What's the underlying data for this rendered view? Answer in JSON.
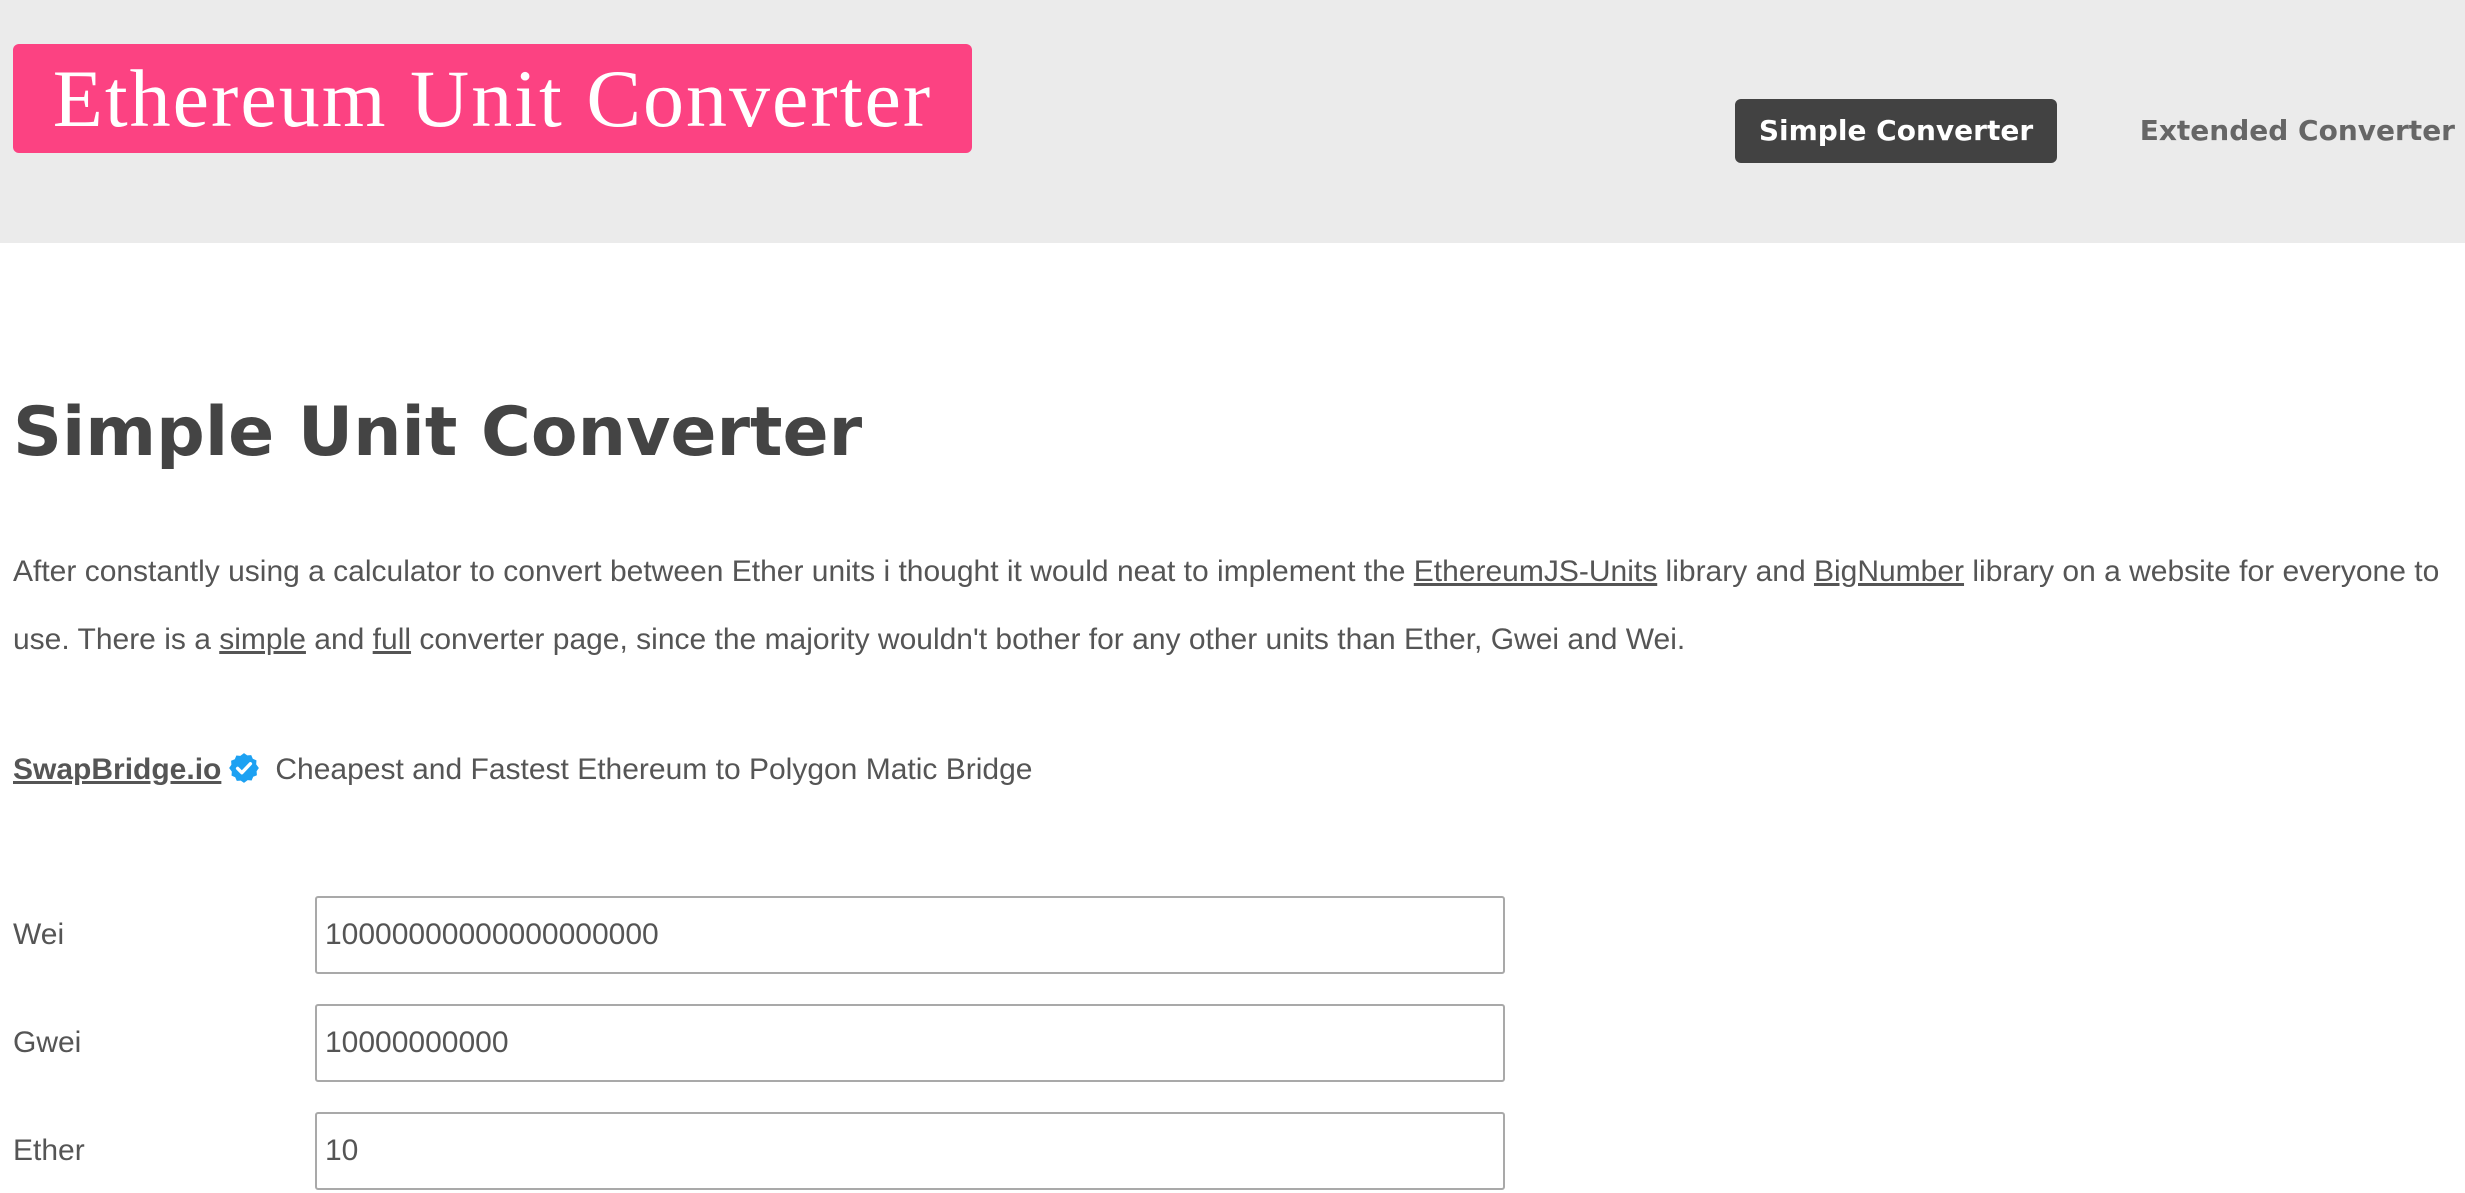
{
  "header": {
    "logo_text": "Ethereum Unit Converter",
    "nav": {
      "simple_label": "Simple Converter",
      "extended_label": "Extended Converter"
    }
  },
  "main": {
    "title": "Simple Unit Converter",
    "intro": {
      "part1": "After constantly using a calculator to convert between Ether units i thought it would neat to implement the ",
      "link_ethereumjs": "EthereumJS-Units",
      "part2": " library and ",
      "link_bignumber": "BigNumber",
      "part3": " library on a website for everyone to use. There is a ",
      "link_simple": "simple",
      "part4": " and ",
      "link_full": "full",
      "part5": " converter page, since the majority wouldn't bother for any other units than Ether, Gwei and Wei."
    },
    "promo": {
      "link_text": "SwapBridge.io",
      "icon": "verified-check-icon",
      "description": "Cheapest and Fastest Ethereum to Polygon Matic Bridge"
    },
    "fields": [
      {
        "label": "Wei",
        "value": "10000000000000000000"
      },
      {
        "label": "Gwei",
        "value": "10000000000"
      },
      {
        "label": "Ether",
        "value": "10"
      }
    ]
  },
  "colors": {
    "logo_bg": "#fc4282",
    "active_nav_bg": "#424242",
    "header_bg": "#ebebeb",
    "verified_badge": "#1da1f2"
  }
}
